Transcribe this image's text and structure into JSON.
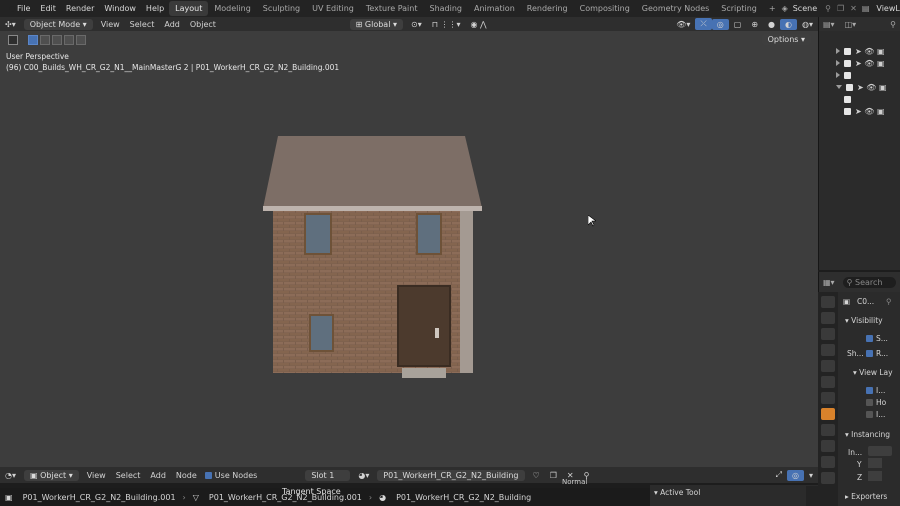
{
  "menubar": {
    "menus": [
      "File",
      "Edit",
      "Render",
      "Window",
      "Help"
    ],
    "workspaces": [
      "Layout",
      "Modeling",
      "Sculpting",
      "UV Editing",
      "Texture Paint",
      "Shading",
      "Animation",
      "Rendering",
      "Compositing",
      "Geometry Nodes",
      "Scripting"
    ],
    "active_workspace": "Layout",
    "add_tab": "+",
    "scene": "Scene",
    "view_layer": "ViewLayer"
  },
  "viewport": {
    "mode": "Object Mode",
    "menus": [
      "View",
      "Select",
      "Add",
      "Object"
    ],
    "transform": "Global",
    "options_label": "Options",
    "perspective_label": "User Perspective",
    "object_info": "(96) C00_Builds_WH_CR_G2_N1__MainMasterG 2 | P01_WorkerH_CR_G2_N2_Building.001"
  },
  "outliner": {
    "search_placeholder": ""
  },
  "properties": {
    "search_placeholder": "Search",
    "object_name": "C0...",
    "sections": {
      "visibility": "Visibility",
      "show_label": "Sh...",
      "check_s": "S...",
      "check_r": "R...",
      "view_layer": "View Lay",
      "view_i": "I...",
      "view_ho": "Ho",
      "view_i2": "I...",
      "instancing": "Instancing",
      "instancing_in": "In...",
      "inst_y": "Y",
      "inst_z": "Z",
      "exporters": "Exporters"
    }
  },
  "node_editor": {
    "editor_type": "Object",
    "menus": [
      "View",
      "Select",
      "Add",
      "Node"
    ],
    "use_nodes_label": "Use Nodes",
    "slot": "Slot 1",
    "material": "P01_WorkerH_CR_G2_N2_Building",
    "overlay_text": "Tangent Space",
    "normal_label": "Normal"
  },
  "breadcrumb": {
    "items": [
      "P01_WorkerH_CR_G2_N2_Building.001",
      "P01_WorkerH_CR_G2_N2_Building.001",
      "P01_WorkerH_CR_G2_N2_Building"
    ]
  },
  "active_tool": {
    "label": "Active Tool"
  },
  "colors": {
    "accent": "#4772b3",
    "logo": "#e87d0d"
  }
}
